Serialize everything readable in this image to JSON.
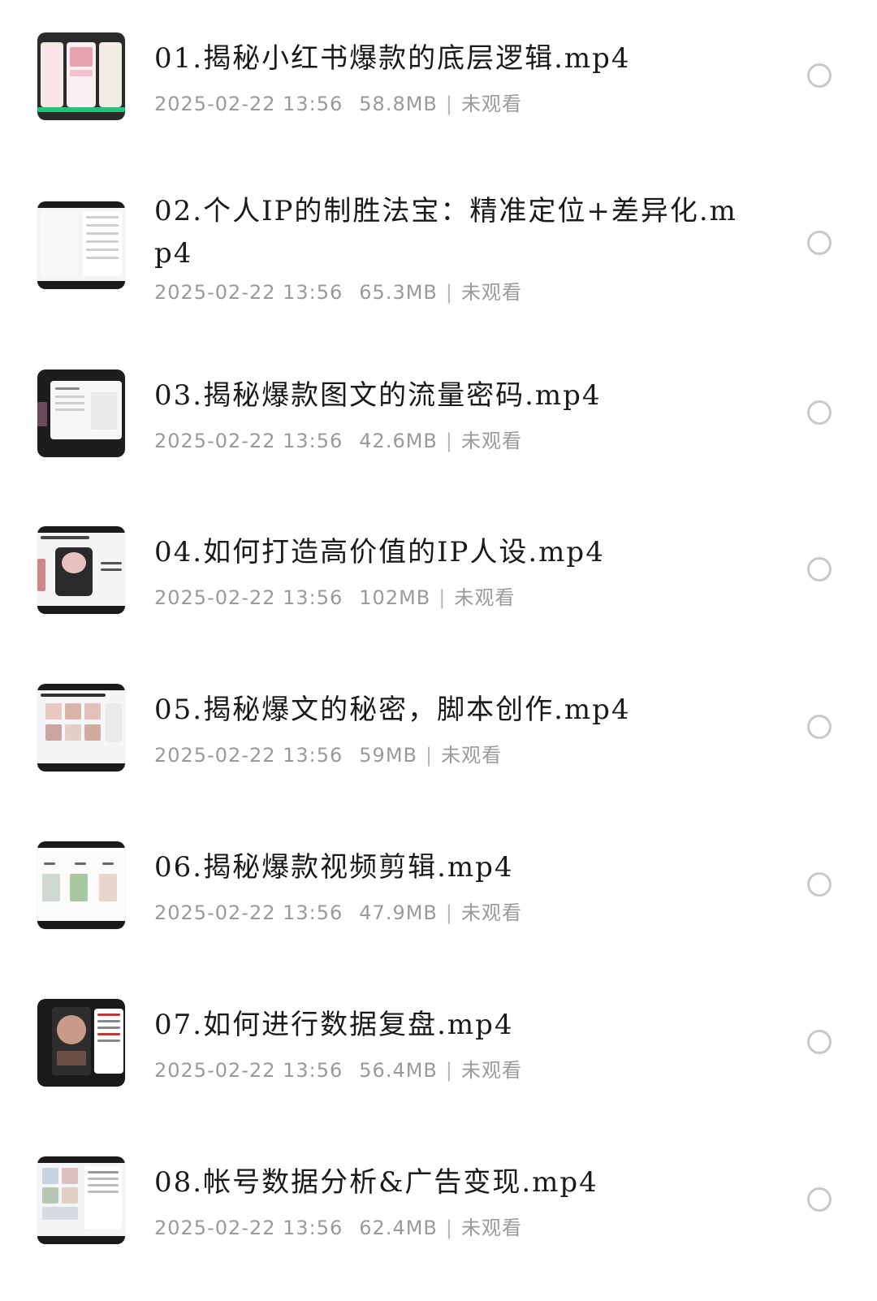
{
  "files": [
    {
      "title": "01.揭秘小红书爆款的底层逻辑.mp4",
      "date": "2025-02-22 13:56",
      "size": "58.8MB",
      "status": "未观看",
      "selected": false,
      "thumb_style": "phones"
    },
    {
      "title": "02.个人IP的制胜法宝：精准定位+差异化.mp4",
      "date": "2025-02-22 13:56",
      "size": "65.3MB",
      "status": "未观看",
      "selected": false,
      "thumb_style": "list"
    },
    {
      "title": "03.揭秘爆款图文的流量密码.mp4",
      "date": "2025-02-22 13:56",
      "size": "42.6MB",
      "status": "未观看",
      "selected": false,
      "thumb_style": "dark-doc"
    },
    {
      "title": "04.如何打造高价值的IP人设.mp4",
      "date": "2025-02-22 13:56",
      "size": "102MB",
      "status": "未观看",
      "selected": false,
      "thumb_style": "phone-center"
    },
    {
      "title": "05.揭秘爆文的秘密，脚本创作.mp4",
      "date": "2025-02-22 13:56",
      "size": "59MB",
      "status": "未观看",
      "selected": false,
      "thumb_style": "grid"
    },
    {
      "title": "06.揭秘爆款视频剪辑.mp4",
      "date": "2025-02-22 13:56",
      "size": "47.9MB",
      "status": "未观看",
      "selected": false,
      "thumb_style": "shots"
    },
    {
      "title": "07.如何进行数据复盘.mp4",
      "date": "2025-02-22 13:56",
      "size": "56.4MB",
      "status": "未观看",
      "selected": false,
      "thumb_style": "phone-text"
    },
    {
      "title": "08.帐号数据分析&广告变现.mp4",
      "date": "2025-02-22 13:56",
      "size": "62.4MB",
      "status": "未观看",
      "selected": false,
      "thumb_style": "collage"
    }
  ],
  "meta_separator": "|"
}
